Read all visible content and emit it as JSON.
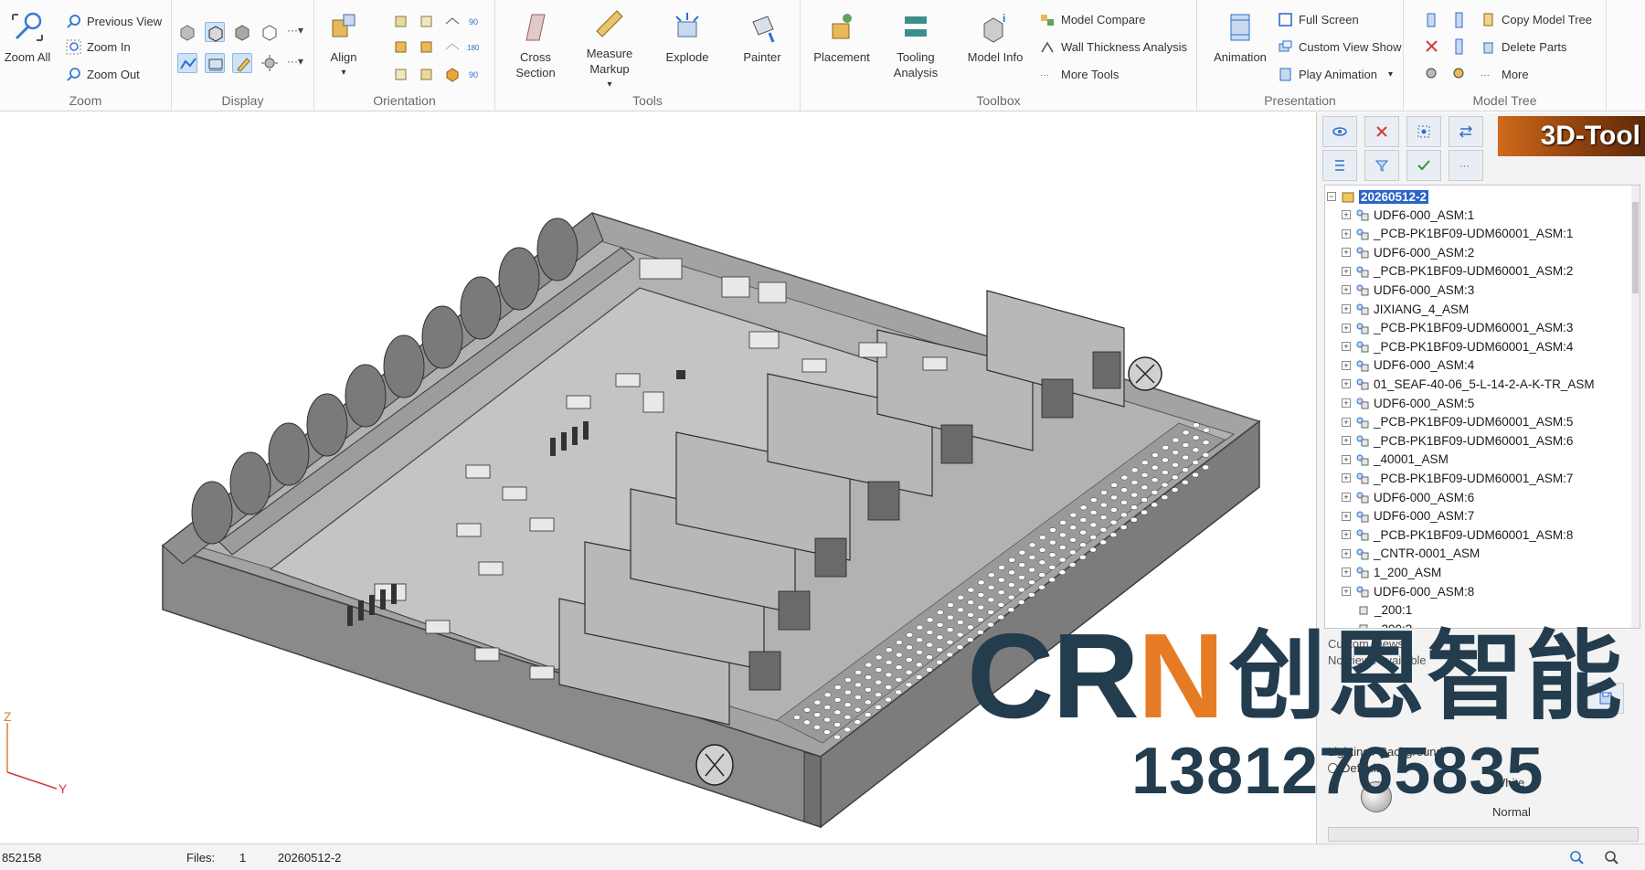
{
  "ribbon": {
    "zoom": {
      "zoom_all": "Zoom All",
      "previous_view": "Previous View",
      "zoom_in": "Zoom In",
      "zoom_out": "Zoom Out",
      "group": "Zoom"
    },
    "display": {
      "group": "Display"
    },
    "orientation": {
      "align": "Align",
      "group": "Orientation"
    },
    "tools": {
      "cross_section": [
        "Cross",
        "Section"
      ],
      "measure_markup": [
        "Measure",
        "Markup"
      ],
      "explode": "Explode",
      "painter": "Painter",
      "group": "Tools"
    },
    "toolbox": {
      "placement": "Placement",
      "tooling_analysis": [
        "Tooling",
        "Analysis"
      ],
      "model_info": "Model Info",
      "model_compare": "Model Compare",
      "wall_thickness": "Wall Thickness Analysis",
      "more_tools": "More Tools",
      "group": "Toolbox"
    },
    "presentation": {
      "animation": "Animation",
      "full_screen": "Full Screen",
      "custom_view_show": "Custom View Show",
      "play_animation": "Play Animation",
      "group": "Presentation"
    },
    "model_tree": {
      "copy_model_tree": "Copy Model Tree",
      "delete_parts": "Delete Parts",
      "more": "More",
      "group": "Model Tree"
    }
  },
  "panel": {
    "brand": "3D-Tool",
    "tree": {
      "root": "20260512-2",
      "items": [
        "UDF6-000_ASM:1",
        "_PCB-PK1BF09-UDM60001_ASM:1",
        "UDF6-000_ASM:2",
        "_PCB-PK1BF09-UDM60001_ASM:2",
        "UDF6-000_ASM:3",
        "JIXIANG_4_ASM",
        "_PCB-PK1BF09-UDM60001_ASM:3",
        "_PCB-PK1BF09-UDM60001_ASM:4",
        "UDF6-000_ASM:4",
        "01_SEAF-40-06_5-L-14-2-A-K-TR_ASM",
        "UDF6-000_ASM:5",
        "_PCB-PK1BF09-UDM60001_ASM:5",
        "_PCB-PK1BF09-UDM60001_ASM:6",
        "_40001_ASM",
        "_PCB-PK1BF09-UDM60001_ASM:7",
        "UDF6-000_ASM:6",
        "UDF6-000_ASM:7",
        "_PCB-PK1BF09-UDM60001_ASM:8",
        "_CNTR-0001_ASM",
        "1_200_ASM",
        "UDF6-000_ASM:8",
        "_200:1",
        "_200:2"
      ]
    },
    "custom_views": "Custom Views",
    "no_views": "No views available",
    "lighting": "Lighting / Background",
    "default_opt": "Default",
    "white_opt": "White",
    "normal_opt": "Normal"
  },
  "axes": {
    "z": "Z",
    "y": "Y"
  },
  "status": {
    "left_value": "852158",
    "files_label": "Files:",
    "files_count": "1",
    "file_name": "20260512-2"
  },
  "watermark": {
    "crn_c": "C",
    "crn_r": "R",
    "crn_n": "N",
    "chinese": "创恩智能",
    "phone": "13812765835"
  },
  "colors": {
    "accent": "#2b64c8",
    "model_fill": "#9a9a9a",
    "brand": "#cf6a1c",
    "watermark_dark": "#233c4e",
    "watermark_orange": "#e57c25"
  }
}
